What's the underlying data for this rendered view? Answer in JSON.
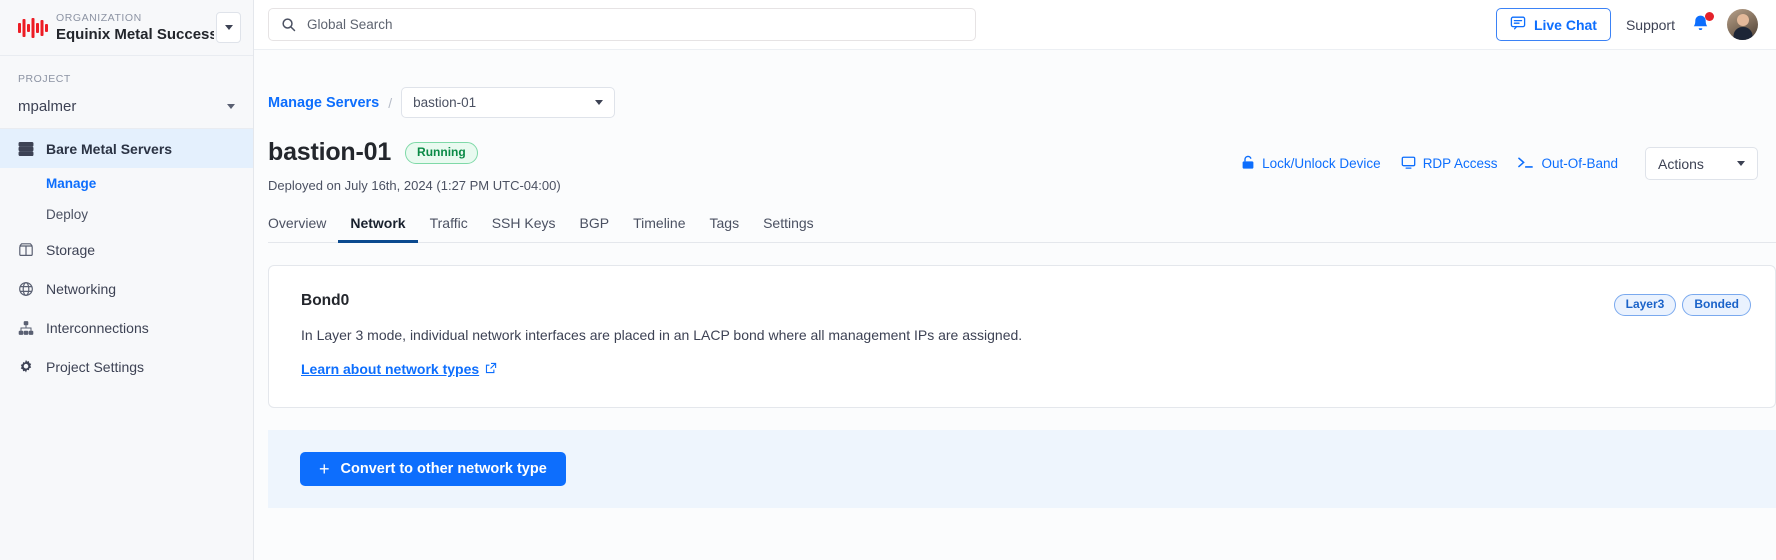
{
  "sidebar": {
    "org_label": "ORGANIZATION",
    "org_name": "Equinix Metal Success",
    "project_label": "PROJECT",
    "project_name": "mpalmer",
    "nav": [
      {
        "label": "Bare Metal Servers",
        "icon": "servers-icon",
        "active": true
      },
      {
        "label": "Storage",
        "icon": "storage-icon",
        "active": false
      },
      {
        "label": "Networking",
        "icon": "networking-icon",
        "active": false
      },
      {
        "label": "Interconnections",
        "icon": "interconnections-icon",
        "active": false
      },
      {
        "label": "Project Settings",
        "icon": "gear-icon",
        "active": false
      }
    ],
    "subnav": [
      {
        "label": "Manage",
        "selected": true
      },
      {
        "label": "Deploy",
        "selected": false
      }
    ]
  },
  "topbar": {
    "search_placeholder": "Global Search",
    "search_value": "",
    "live_chat": "Live Chat",
    "support": "Support",
    "notification_count": ""
  },
  "breadcrumb": {
    "parent": "Manage Servers",
    "separator": "/",
    "server_selected": "bastion-01"
  },
  "header": {
    "title": "bastion-01",
    "status": "Running",
    "deployed": "Deployed on July 16th, 2024 (1:27 PM UTC-04:00)",
    "actions": [
      {
        "label": "Lock/Unlock Device",
        "icon": "lock-icon"
      },
      {
        "label": "RDP Access",
        "icon": "monitor-icon"
      },
      {
        "label": "Out-Of-Band",
        "icon": "terminal-icon"
      }
    ],
    "actions_menu": "Actions"
  },
  "tabs": [
    {
      "label": "Overview",
      "active": false
    },
    {
      "label": "Network",
      "active": true
    },
    {
      "label": "Traffic",
      "active": false
    },
    {
      "label": "SSH Keys",
      "active": false
    },
    {
      "label": "BGP",
      "active": false
    },
    {
      "label": "Timeline",
      "active": false
    },
    {
      "label": "Tags",
      "active": false
    },
    {
      "label": "Settings",
      "active": false
    }
  ],
  "bond_card": {
    "title": "Bond0",
    "description": "In Layer 3 mode, individual network interfaces are placed in an LACP bond where all management IPs are assigned.",
    "link": "Learn about network types",
    "badges": [
      "Layer3",
      "Bonded"
    ]
  },
  "convert": {
    "button_label": "Convert to other network type",
    "plus": "+"
  },
  "colors": {
    "accent_blue": "#0d6efd",
    "tab_underline": "#0b4a8f",
    "running_green": "#0a8a46",
    "panel_blue": "#eef5fd",
    "brand_red": "#e4222b"
  }
}
